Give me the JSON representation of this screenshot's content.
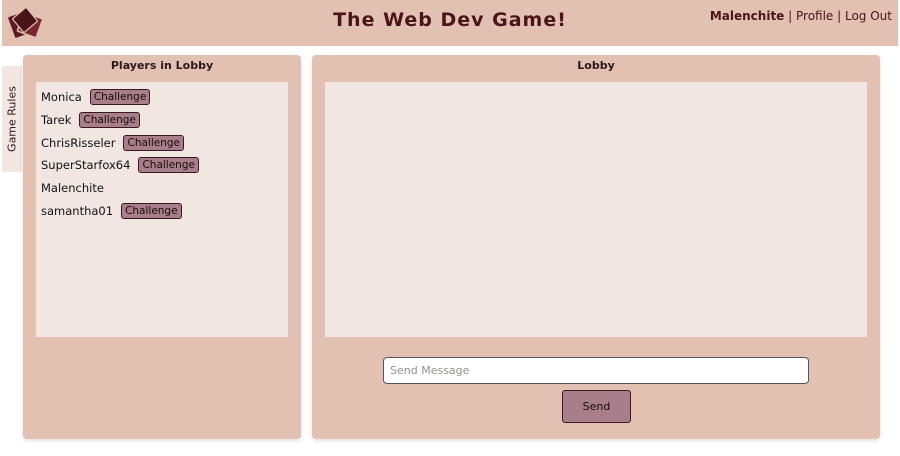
{
  "header": {
    "title": "The Web Dev Game!",
    "username": "Malenchite",
    "separator1": " | ",
    "profile_label": "Profile",
    "separator2": " | ",
    "logout_label": "Log Out",
    "logo_icon": "card-deck-logo"
  },
  "sidebar": {
    "rules_tab": "Game Rules"
  },
  "players_panel": {
    "title": "Players in Lobby",
    "players": [
      {
        "name": "Monica",
        "action": "Challenge"
      },
      {
        "name": "Tarek",
        "action": "Challenge"
      },
      {
        "name": "ChrisRisseler",
        "action": "Challenge"
      },
      {
        "name": "SuperStarfox64",
        "action": "Challenge"
      },
      {
        "name": "Malenchite"
      },
      {
        "name": "samantha01",
        "action": "Challenge"
      }
    ]
  },
  "lobby_panel": {
    "title": "Lobby",
    "message_placeholder": "Send Message",
    "send_label": "Send"
  },
  "colors": {
    "panel": "#e2c1b3",
    "inner": "#f1e6e2",
    "button": "#a77e89",
    "title_text": "#4a1418"
  }
}
